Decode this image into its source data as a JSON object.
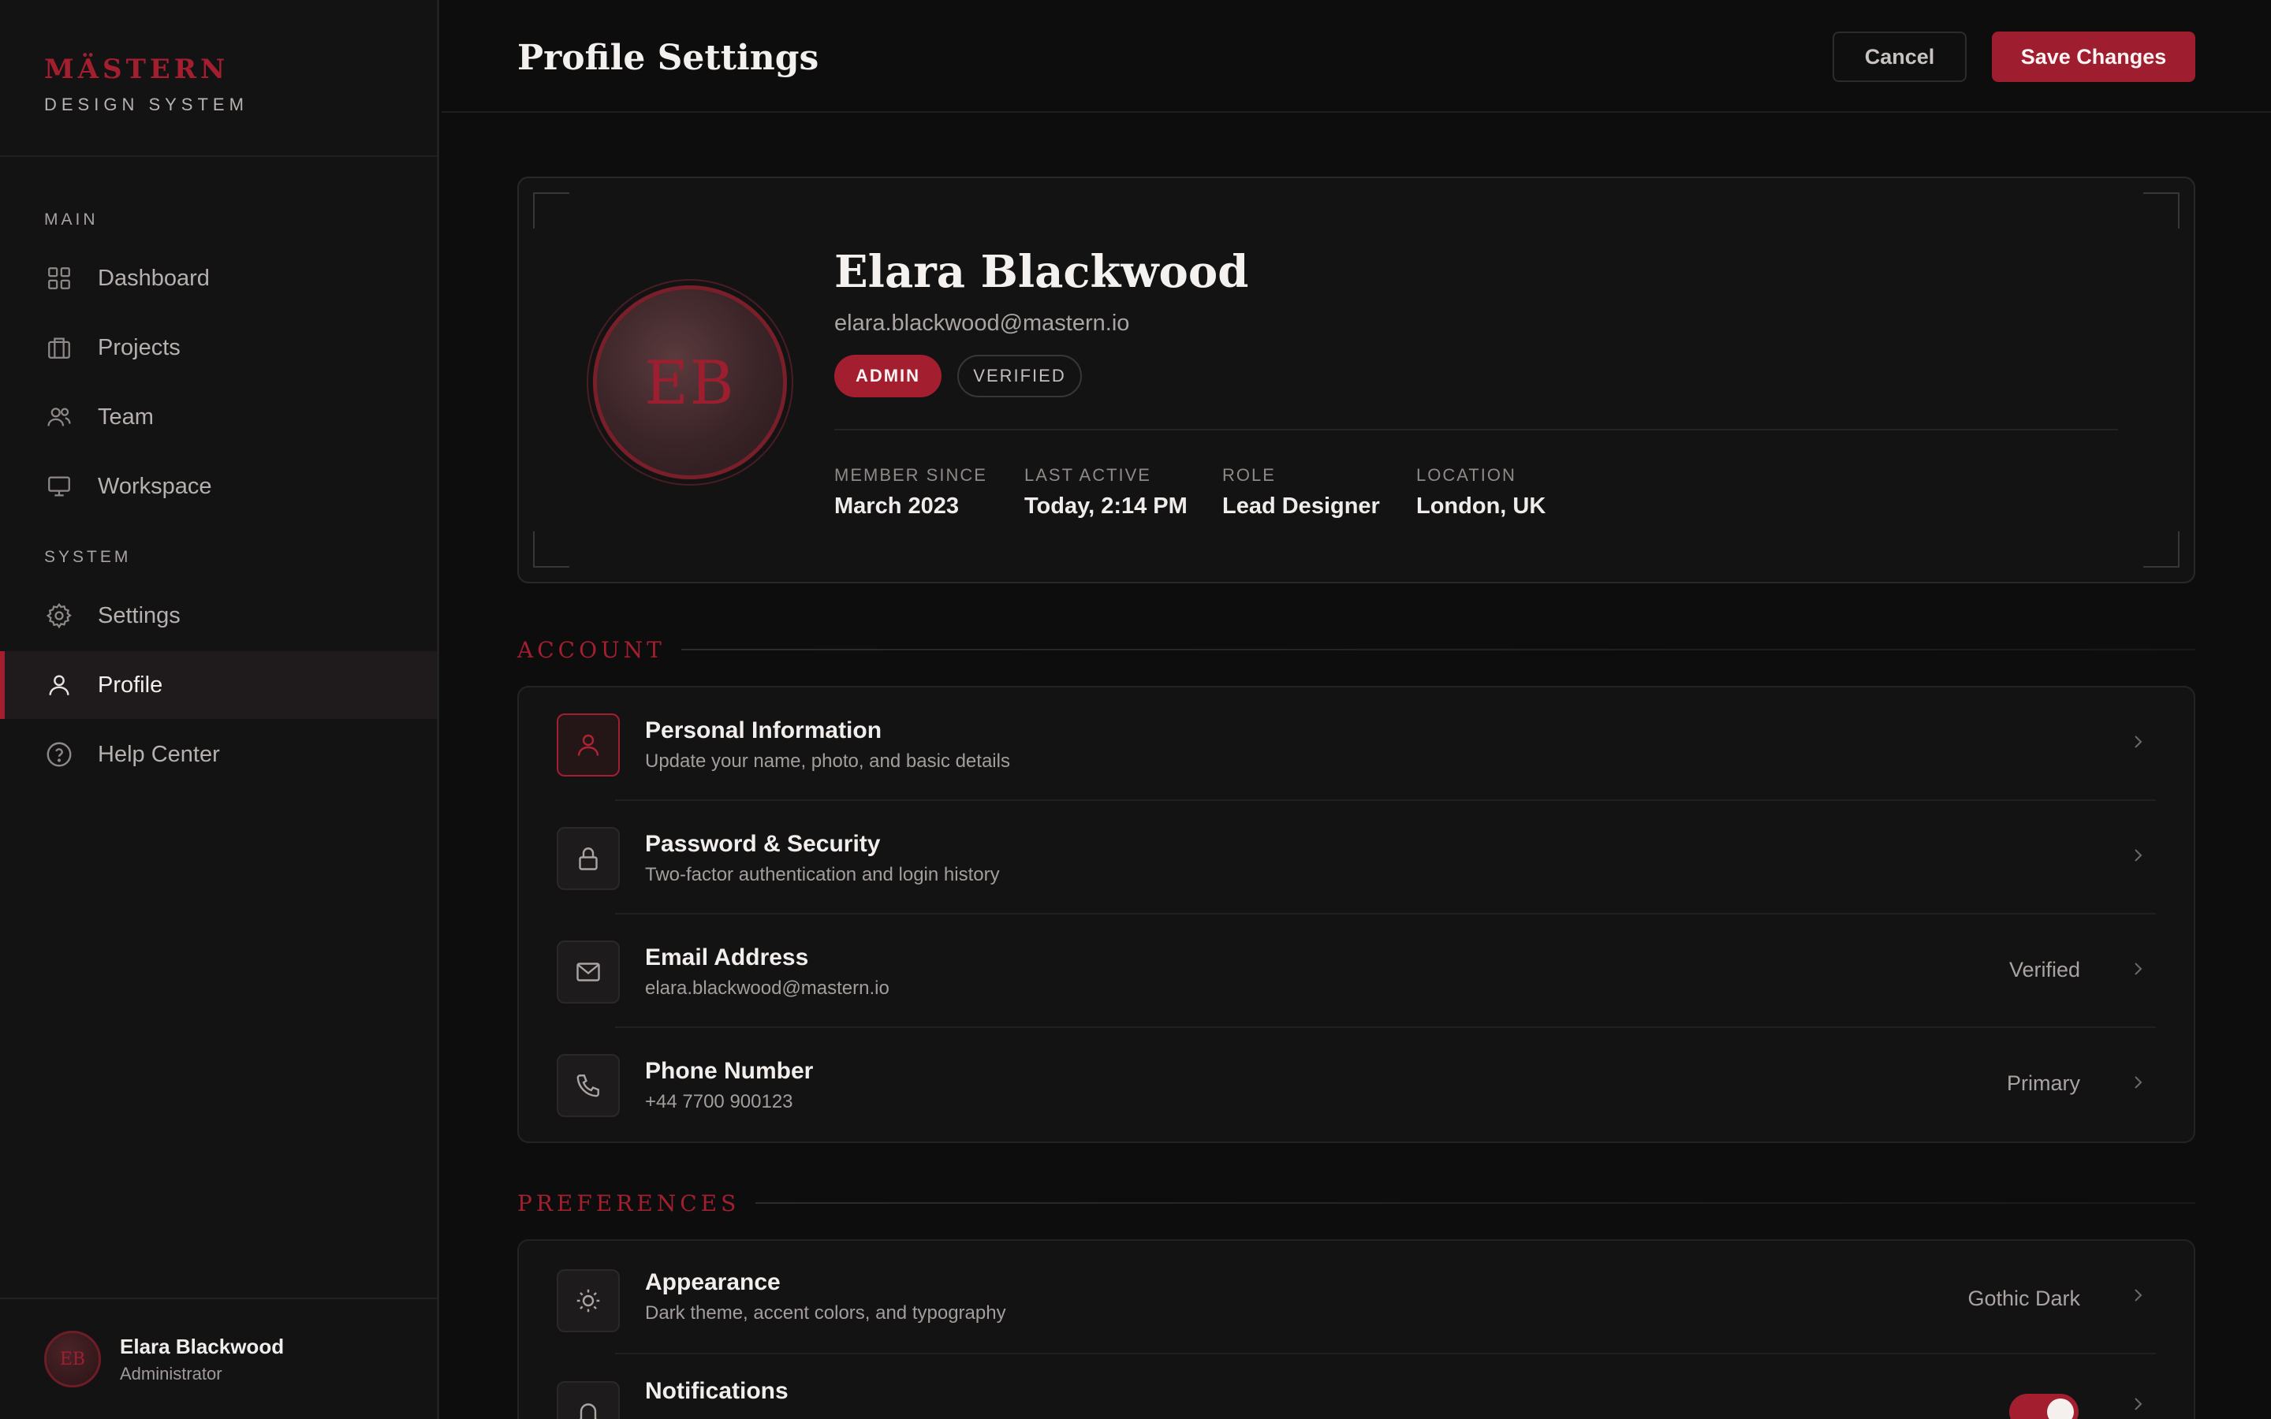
{
  "brand": {
    "name": "MÄSTERN",
    "subtitle": "DESIGN SYSTEM"
  },
  "sidebar": {
    "sections": [
      {
        "label": "MAIN"
      },
      {
        "label": "SYSTEM"
      }
    ],
    "items": [
      {
        "label": "Dashboard",
        "icon": "grid-icon"
      },
      {
        "label": "Projects",
        "icon": "briefcase-icon"
      },
      {
        "label": "Team",
        "icon": "users-icon"
      },
      {
        "label": "Workspace",
        "icon": "monitor-icon"
      },
      {
        "label": "Settings",
        "icon": "gear-icon"
      },
      {
        "label": "Profile",
        "icon": "user-icon",
        "active": true
      },
      {
        "label": "Help Center",
        "icon": "help-circle-icon"
      }
    ],
    "footer": {
      "initials": "EB",
      "name": "Elara Blackwood",
      "role": "Administrator"
    }
  },
  "header": {
    "title": "Profile Settings",
    "cancel_label": "Cancel",
    "save_label": "Save Changes"
  },
  "profile": {
    "initials": "EB",
    "name": "Elara Blackwood",
    "email": "elara.blackwood@mastern.io",
    "badges": [
      "ADMIN",
      "VERIFIED"
    ],
    "meta": [
      {
        "label": "MEMBER SINCE",
        "value": "March 2023"
      },
      {
        "label": "LAST ACTIVE",
        "value": "Today, 2:14 PM"
      },
      {
        "label": "ROLE",
        "value": "Lead Designer"
      },
      {
        "label": "LOCATION",
        "value": "London, UK"
      }
    ]
  },
  "account": {
    "title": "ACCOUNT",
    "rows": [
      {
        "title": "Personal Information",
        "subtitle": "Update your name, photo, and basic details",
        "value": "",
        "icon": "user-icon"
      },
      {
        "title": "Password & Security",
        "subtitle": "Two-factor authentication and login history",
        "value": "",
        "icon": "lock-icon"
      },
      {
        "title": "Email Address",
        "subtitle": "elara.blackwood@mastern.io",
        "value": "Verified",
        "icon": "mail-icon"
      },
      {
        "title": "Phone Number",
        "subtitle": "+44 7700 900123",
        "value": "Primary",
        "icon": "phone-icon"
      }
    ]
  },
  "preferences": {
    "title": "PREFERENCES",
    "rows": [
      {
        "title": "Appearance",
        "subtitle": "Dark theme, accent colors, and typography",
        "value": "Gothic Dark",
        "icon": "sun-icon"
      },
      {
        "title": "Notifications",
        "subtitle": "",
        "value": "",
        "icon": "bell-icon",
        "toggle_on": true
      }
    ]
  },
  "colors": {
    "accent": "#a31f30",
    "background": "#0d0d0e",
    "sidebar": "#141314"
  }
}
